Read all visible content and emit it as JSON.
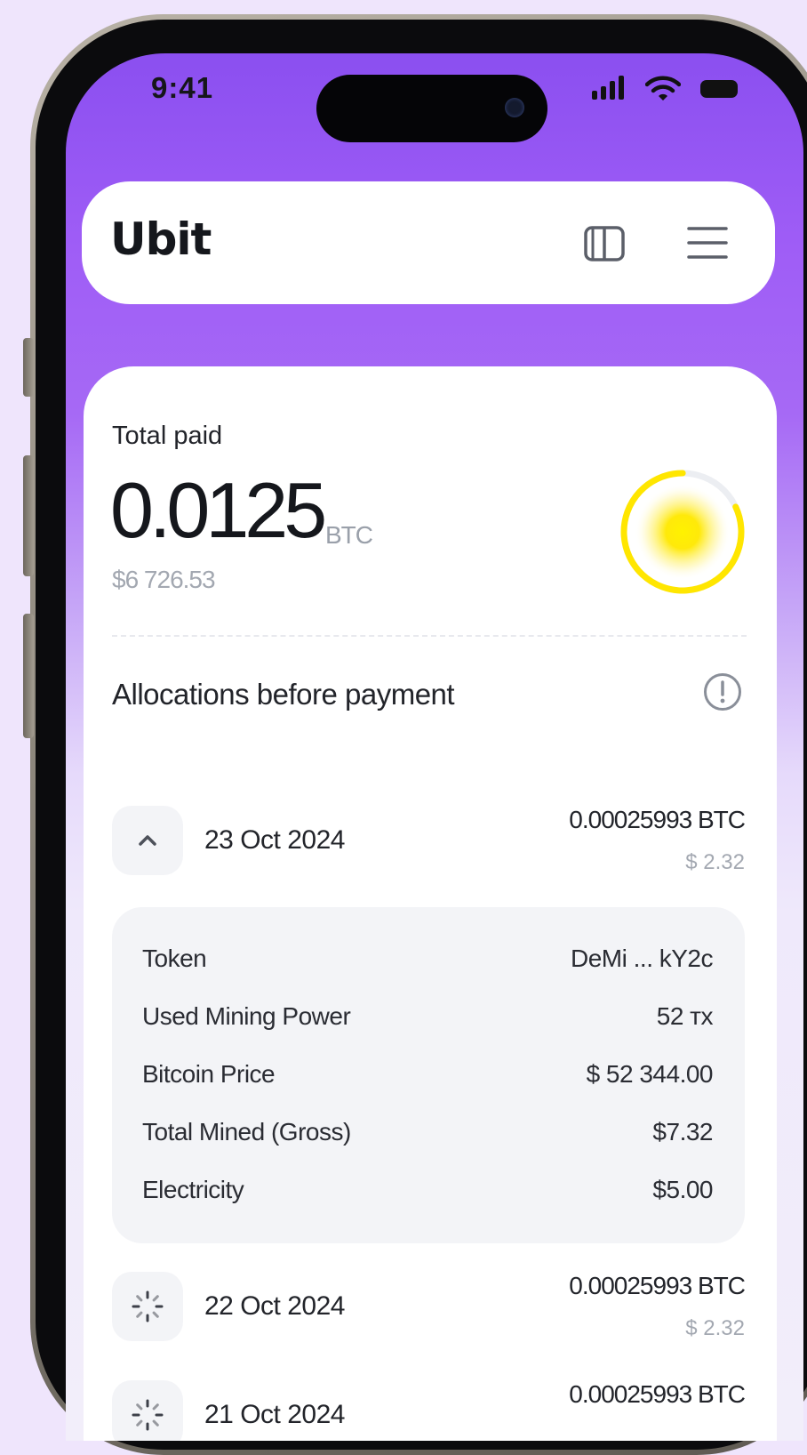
{
  "status_bar": {
    "time": "9:41",
    "icons": [
      "signal-icon",
      "wifi-icon",
      "battery-icon"
    ]
  },
  "header": {
    "logo": "Ubit",
    "icons": [
      "book-icon",
      "menu-icon"
    ]
  },
  "summary": {
    "label": "Total paid",
    "amount": "0.0125",
    "unit": "BTC",
    "fiat": "$6 726.53",
    "progress_ring": {
      "fraction": 0.82,
      "color": "#ffe600"
    }
  },
  "allocations": {
    "title": "Allocations before payment",
    "days": [
      {
        "date": "23 Oct 2024",
        "btc": "0.00025993 BTC",
        "usd": "$ 2.32",
        "state": "expanded"
      },
      {
        "date": "22 Oct 2024",
        "btc": "0.00025993 BTC",
        "usd": "$ 2.32",
        "state": "loading"
      },
      {
        "date": "21 Oct 2024",
        "btc": "0.00025993 BTC",
        "usd": "",
        "state": "loading"
      }
    ],
    "details": [
      {
        "label": "Token",
        "value": "DeMi ... kY2c"
      },
      {
        "label": "Used Mining Power",
        "value": "52 тх"
      },
      {
        "label": "Bitcoin Price",
        "value": "$ 52 344.00"
      },
      {
        "label": "Total Mined (Gross)",
        "value": "$7.32"
      },
      {
        "label": "Electricity",
        "value": "$5.00"
      }
    ]
  },
  "colors": {
    "accent_purple": "#9f5df6",
    "ring_yellow": "#ffe600",
    "text_dark": "#22242a",
    "text_muted": "#a3a8b1"
  }
}
